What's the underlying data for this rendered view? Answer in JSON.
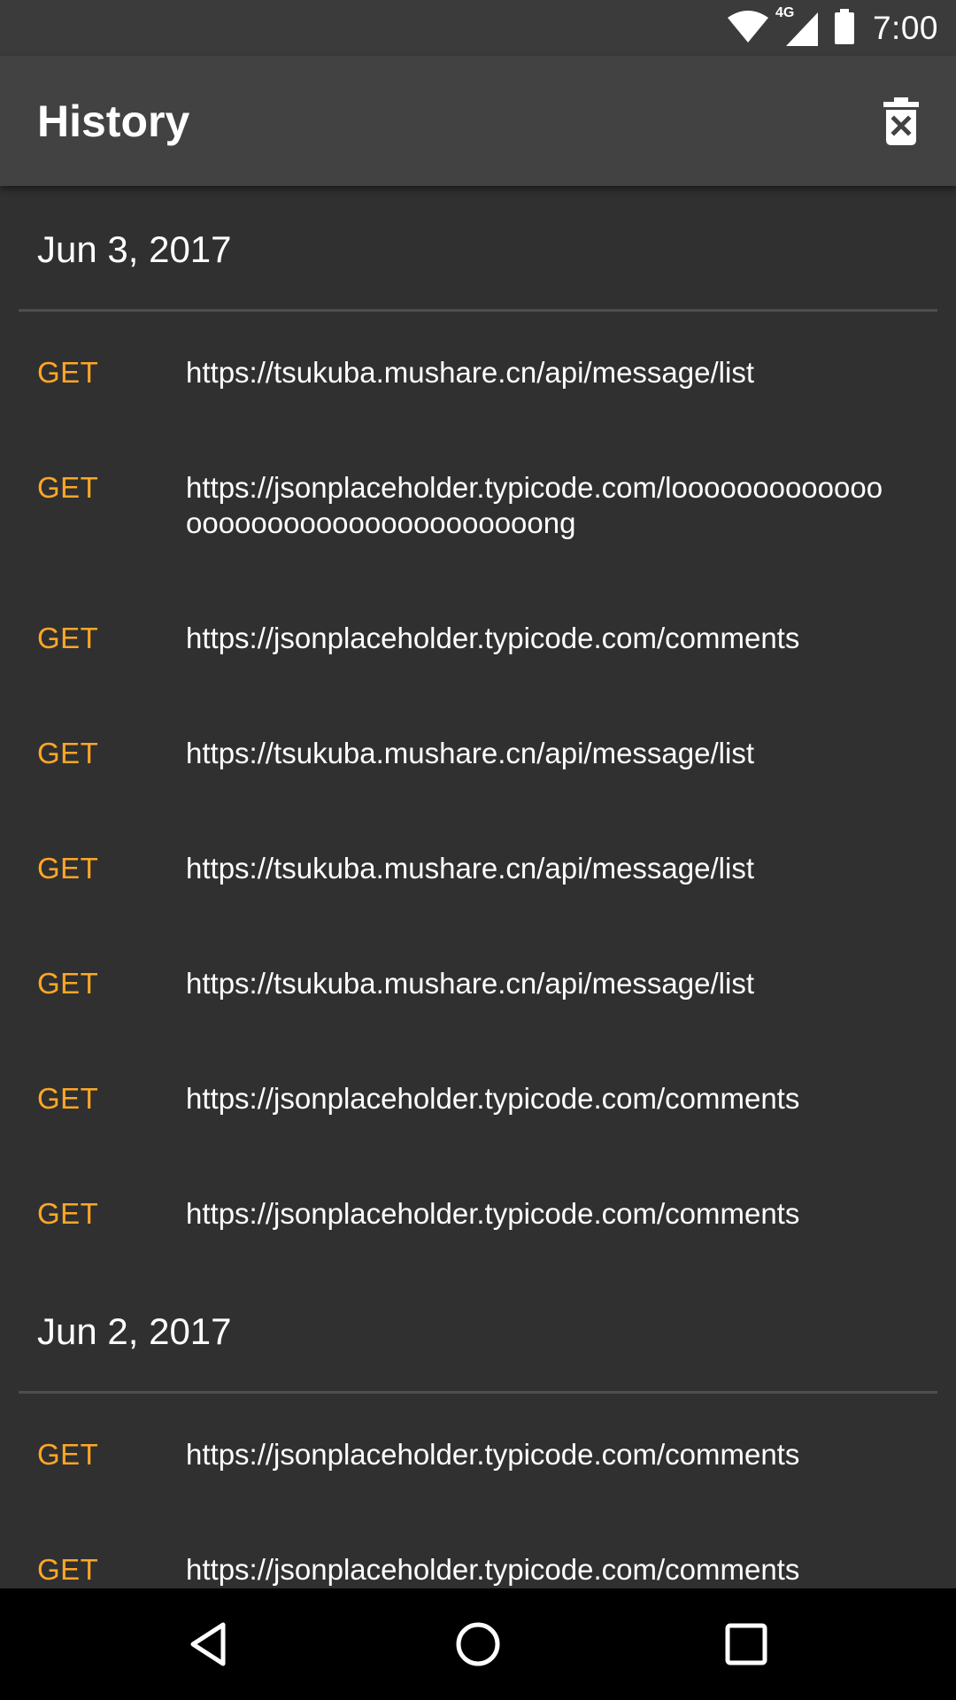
{
  "status_bar": {
    "time": "7:00",
    "network": "4G",
    "icons": [
      "wifi-icon",
      "cell-signal-icon",
      "battery-icon"
    ]
  },
  "app_bar": {
    "title": "History",
    "action_icon": "delete-forever-icon"
  },
  "colors": {
    "method": "#ffa726",
    "background": "#303030",
    "app_bar": "#424242"
  },
  "sections": [
    {
      "date": "Jun 3, 2017",
      "items": [
        {
          "method": "GET",
          "url": "https://tsukuba.mushare.cn/api/message/list"
        },
        {
          "method": "GET",
          "url": "https://jsonplaceholder.typicode.com/looooooooooooooooooooooooooooooooooong"
        },
        {
          "method": "GET",
          "url": "https://jsonplaceholder.typicode.com/comments"
        },
        {
          "method": "GET",
          "url": "https://tsukuba.mushare.cn/api/message/list"
        },
        {
          "method": "GET",
          "url": "https://tsukuba.mushare.cn/api/message/list"
        },
        {
          "method": "GET",
          "url": "https://tsukuba.mushare.cn/api/message/list"
        },
        {
          "method": "GET",
          "url": "https://jsonplaceholder.typicode.com/comments"
        },
        {
          "method": "GET",
          "url": "https://jsonplaceholder.typicode.com/comments"
        }
      ]
    },
    {
      "date": "Jun 2, 2017",
      "items": [
        {
          "method": "GET",
          "url": "https://jsonplaceholder.typicode.com/comments"
        },
        {
          "method": "GET",
          "url": "https://jsonplaceholder.typicode.com/comments"
        }
      ]
    }
  ],
  "nav_bar": {
    "icons": [
      "back-icon",
      "home-icon",
      "recents-icon"
    ]
  }
}
